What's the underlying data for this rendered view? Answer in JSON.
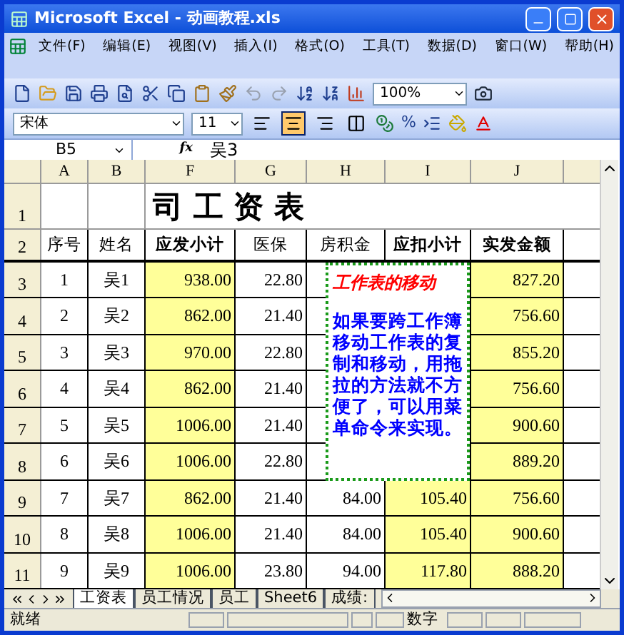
{
  "window": {
    "title": "Microsoft Excel - 动画教程.xls"
  },
  "menu": [
    "文件(F)",
    "编辑(E)",
    "视图(V)",
    "插入(I)",
    "格式(O)",
    "工具(T)",
    "数据(D)",
    "窗口(W)",
    "帮助(H)"
  ],
  "standard_toolbar": {
    "zoom": "100%"
  },
  "format_toolbar": {
    "font": "宋体",
    "size": "11",
    "percent": "%",
    "align": [
      {
        "kind": "left",
        "selected": false
      },
      {
        "kind": "center",
        "selected": true
      },
      {
        "kind": "right",
        "selected": false
      },
      {
        "kind": "merge",
        "selected": false
      }
    ]
  },
  "formula_bar": {
    "name_box": "B5",
    "fx": "fx",
    "value": "吴3"
  },
  "columns": [
    {
      "letter": "A",
      "highlight": false
    },
    {
      "letter": "B",
      "highlight": false
    },
    {
      "letter": "F",
      "highlight": true
    },
    {
      "letter": "G",
      "highlight": false
    },
    {
      "letter": "H",
      "highlight": false
    },
    {
      "letter": "I",
      "highlight": true
    },
    {
      "letter": "J",
      "highlight": true
    }
  ],
  "title_row": {
    "row": "1",
    "text": "司 工 资 表"
  },
  "header_row": {
    "row": "2",
    "cells": [
      {
        "text": "序号",
        "bold": false
      },
      {
        "text": "姓名",
        "bold": false
      },
      {
        "text": "应发小计",
        "bold": true
      },
      {
        "text": "医保",
        "bold": false
      },
      {
        "text": "房积金",
        "bold": false
      },
      {
        "text": "应扣小计",
        "bold": true
      },
      {
        "text": "实发金额",
        "bold": true
      }
    ]
  },
  "rows": [
    {
      "row": "3",
      "cells": [
        "1",
        "吴1",
        "938.00",
        "22.80",
        "",
        "",
        "827.20"
      ]
    },
    {
      "row": "4",
      "cells": [
        "2",
        "吴2",
        "862.00",
        "21.40",
        "",
        "",
        "756.60"
      ]
    },
    {
      "row": "5",
      "cells": [
        "3",
        "吴3",
        "970.00",
        "22.80",
        "",
        "",
        "855.20"
      ]
    },
    {
      "row": "6",
      "cells": [
        "4",
        "吴4",
        "862.00",
        "21.40",
        "",
        "",
        "756.60"
      ]
    },
    {
      "row": "7",
      "cells": [
        "5",
        "吴5",
        "1006.00",
        "21.40",
        "",
        "",
        "900.60"
      ]
    },
    {
      "row": "8",
      "cells": [
        "6",
        "吴6",
        "1006.00",
        "22.80",
        "",
        "",
        "889.20"
      ]
    },
    {
      "row": "9",
      "cells": [
        "7",
        "吴7",
        "862.00",
        "21.40",
        "84.00",
        "105.40",
        "756.60"
      ]
    },
    {
      "row": "10",
      "cells": [
        "8",
        "吴8",
        "1006.00",
        "21.40",
        "84.00",
        "105.40",
        "900.60"
      ]
    },
    {
      "row": "11",
      "cells": [
        "9",
        "吴9",
        "1006.00",
        "23.80",
        "94.00",
        "117.80",
        "888.20"
      ]
    }
  ],
  "text_box": {
    "title": "工作表的移动",
    "body": "如果要跨工作簿移动工作表的复制和移动，用拖拉的方法就不方便了，可以用菜单命令来实现。"
  },
  "sheet_tabs": [
    {
      "label": "工资表",
      "selected": true
    },
    {
      "label": "员工情况",
      "selected": false
    },
    {
      "label": "员工",
      "selected": false
    },
    {
      "label": "Sheet6",
      "selected": false
    },
    {
      "label": "成绩:",
      "selected": false
    }
  ],
  "status_bar": {
    "left": "就绪",
    "mode": "数字"
  }
}
